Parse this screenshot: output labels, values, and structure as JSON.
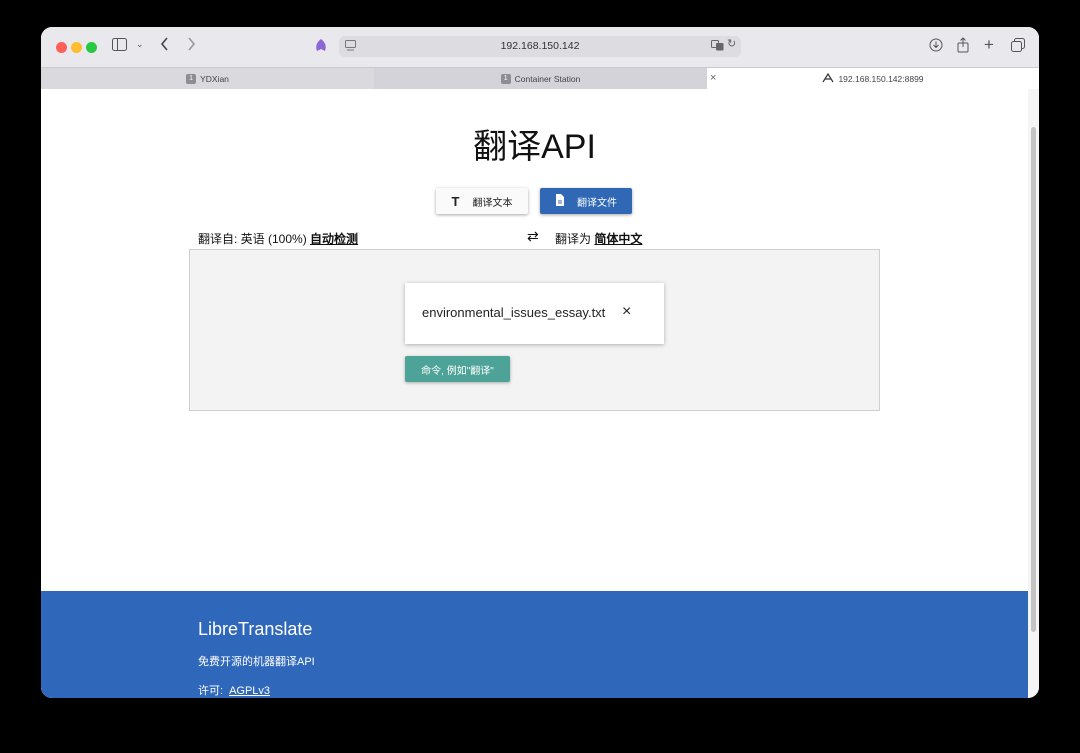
{
  "browser": {
    "url": "192.168.150.142",
    "tabs": [
      {
        "number": "1",
        "title": "YDXian"
      },
      {
        "number": "1",
        "title": "Container Station"
      },
      {
        "title": "192.168.150.142:8899"
      }
    ],
    "close_tab_glyph": "×"
  },
  "page": {
    "title": "翻译API",
    "mode_buttons": {
      "text_label": "翻译文本",
      "file_label": "翻译文件"
    },
    "source": {
      "prefix": "翻译自: 英语 (100%)",
      "selected": "自动检测"
    },
    "target": {
      "prefix": "翻译为",
      "selected": "简体中文"
    },
    "file": {
      "name": "environmental_issues_essay.txt",
      "remove_glyph": "×"
    },
    "translate_button": "命令, 例如\"翻译\""
  },
  "footer": {
    "title": "LibreTranslate",
    "description": "免费开源的机器翻译API",
    "license_label": "许可:",
    "license_link": "AGPLv3"
  },
  "colors": {
    "accent": "#3168b6",
    "translate_button": "#4ea399",
    "footer": "#2f68bb"
  }
}
